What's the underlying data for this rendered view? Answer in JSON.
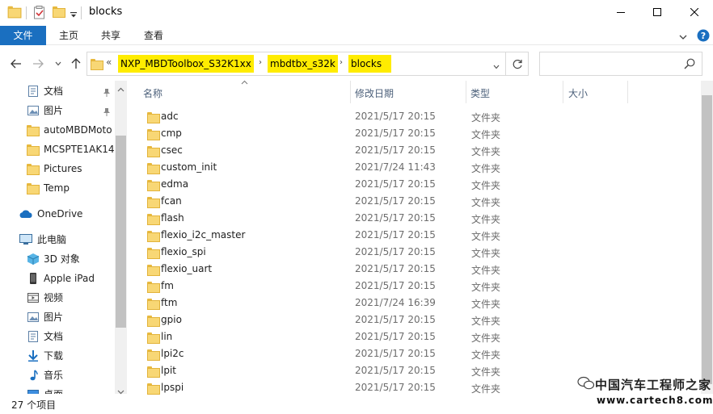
{
  "window": {
    "title": "blocks"
  },
  "ribbon": {
    "tabs": [
      {
        "label": "文件"
      },
      {
        "label": "主页"
      },
      {
        "label": "共享"
      },
      {
        "label": "查看"
      }
    ]
  },
  "address": {
    "overflow": "«",
    "crumbs": [
      "NXP_MBDToolbox_S32K1xx",
      "mbdtbx_s32k",
      "blocks"
    ],
    "search_placeholder": ""
  },
  "nav": {
    "items": [
      {
        "label": "文档",
        "icon": "documents-icon",
        "pinned": true
      },
      {
        "label": "图片",
        "icon": "pictures-icon",
        "pinned": true
      },
      {
        "label": "autoMBDMoto",
        "icon": "folder-icon",
        "pinned": false
      },
      {
        "label": "MCSPTE1AK14",
        "icon": "folder-icon",
        "pinned": false
      },
      {
        "label": "Pictures",
        "icon": "folder-icon",
        "pinned": false
      },
      {
        "label": "Temp",
        "icon": "folder-icon",
        "pinned": false
      },
      {
        "label": "OneDrive",
        "icon": "onedrive-icon",
        "pinned": false
      },
      {
        "label": "此电脑",
        "icon": "this-pc-icon",
        "pinned": false
      },
      {
        "label": "3D 对象",
        "icon": "3d-objects-icon",
        "pinned": false
      },
      {
        "label": "Apple iPad",
        "icon": "ipad-icon",
        "pinned": false
      },
      {
        "label": "视频",
        "icon": "videos-icon",
        "pinned": false
      },
      {
        "label": "图片",
        "icon": "pictures-icon",
        "pinned": false
      },
      {
        "label": "文档",
        "icon": "documents-icon",
        "pinned": false
      },
      {
        "label": "下载",
        "icon": "downloads-icon",
        "pinned": false
      },
      {
        "label": "音乐",
        "icon": "music-icon",
        "pinned": false
      },
      {
        "label": "桌面",
        "icon": "desktop-icon",
        "pinned": false
      }
    ]
  },
  "list": {
    "columns": [
      "名称",
      "修改日期",
      "类型",
      "大小"
    ],
    "rows": [
      {
        "name": "adc",
        "date": "2021/5/17 20:15",
        "type": "文件夹"
      },
      {
        "name": "cmp",
        "date": "2021/5/17 20:15",
        "type": "文件夹"
      },
      {
        "name": "csec",
        "date": "2021/5/17 20:15",
        "type": "文件夹"
      },
      {
        "name": "custom_init",
        "date": "2021/7/24 11:43",
        "type": "文件夹"
      },
      {
        "name": "edma",
        "date": "2021/5/17 20:15",
        "type": "文件夹"
      },
      {
        "name": "fcan",
        "date": "2021/5/17 20:15",
        "type": "文件夹"
      },
      {
        "name": "flash",
        "date": "2021/5/17 20:15",
        "type": "文件夹"
      },
      {
        "name": "flexio_i2c_master",
        "date": "2021/5/17 20:15",
        "type": "文件夹"
      },
      {
        "name": "flexio_spi",
        "date": "2021/5/17 20:15",
        "type": "文件夹"
      },
      {
        "name": "flexio_uart",
        "date": "2021/5/17 20:15",
        "type": "文件夹"
      },
      {
        "name": "fm",
        "date": "2021/5/17 20:15",
        "type": "文件夹"
      },
      {
        "name": "ftm",
        "date": "2021/7/24 16:39",
        "type": "文件夹"
      },
      {
        "name": "gpio",
        "date": "2021/5/17 20:15",
        "type": "文件夹"
      },
      {
        "name": "lin",
        "date": "2021/5/17 20:15",
        "type": "文件夹"
      },
      {
        "name": "lpi2c",
        "date": "2021/5/17 20:15",
        "type": "文件夹"
      },
      {
        "name": "lpit",
        "date": "2021/5/17 20:15",
        "type": "文件夹"
      },
      {
        "name": "lpspi",
        "date": "2021/5/17 20:15",
        "type": "文件夹"
      }
    ]
  },
  "status": {
    "item_count": "27 个项目"
  },
  "watermark": {
    "line1": "中国汽车工程师之家",
    "line2": "www.cartech8.com"
  },
  "colors": {
    "accent": "#1a6fc0",
    "highlight": "#ffec00",
    "folder": "#f8d775"
  }
}
